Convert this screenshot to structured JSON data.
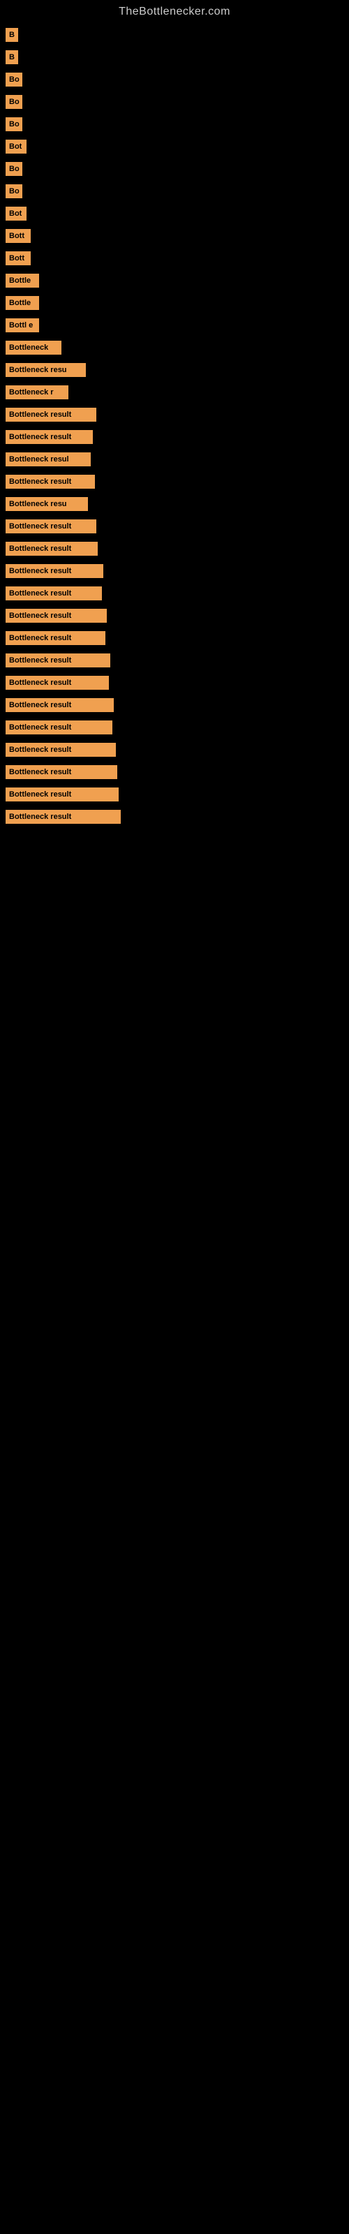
{
  "site": {
    "title": "TheBottlenecker.com"
  },
  "bars": [
    {
      "label": "B",
      "width": 18
    },
    {
      "label": "B",
      "width": 18
    },
    {
      "label": "Bo",
      "width": 24
    },
    {
      "label": "Bo",
      "width": 24
    },
    {
      "label": "Bo",
      "width": 24
    },
    {
      "label": "Bot",
      "width": 30
    },
    {
      "label": "Bo",
      "width": 24
    },
    {
      "label": "Bo",
      "width": 24
    },
    {
      "label": "Bot",
      "width": 30
    },
    {
      "label": "Bott",
      "width": 36
    },
    {
      "label": "Bott",
      "width": 36
    },
    {
      "label": "Bottle",
      "width": 48
    },
    {
      "label": "Bottle",
      "width": 48
    },
    {
      "label": "Bottl e",
      "width": 48
    },
    {
      "label": "Bottleneck",
      "width": 80
    },
    {
      "label": "Bottleneck resu",
      "width": 115
    },
    {
      "label": "Bottleneck r",
      "width": 90
    },
    {
      "label": "Bottleneck result",
      "width": 130
    },
    {
      "label": "Bottleneck result",
      "width": 125
    },
    {
      "label": "Bottleneck resul",
      "width": 122
    },
    {
      "label": "Bottleneck result",
      "width": 128
    },
    {
      "label": "Bottleneck resu",
      "width": 118
    },
    {
      "label": "Bottleneck result",
      "width": 130
    },
    {
      "label": "Bottleneck result",
      "width": 132
    },
    {
      "label": "Bottleneck result",
      "width": 140
    },
    {
      "label": "Bottleneck result",
      "width": 138
    },
    {
      "label": "Bottleneck result",
      "width": 145
    },
    {
      "label": "Bottleneck result",
      "width": 143
    },
    {
      "label": "Bottleneck result",
      "width": 150
    },
    {
      "label": "Bottleneck result",
      "width": 148
    },
    {
      "label": "Bottleneck result",
      "width": 155
    },
    {
      "label": "Bottleneck result",
      "width": 153
    },
    {
      "label": "Bottleneck result",
      "width": 158
    },
    {
      "label": "Bottleneck result",
      "width": 160
    },
    {
      "label": "Bottleneck result",
      "width": 162
    },
    {
      "label": "Bottleneck result",
      "width": 165
    }
  ]
}
